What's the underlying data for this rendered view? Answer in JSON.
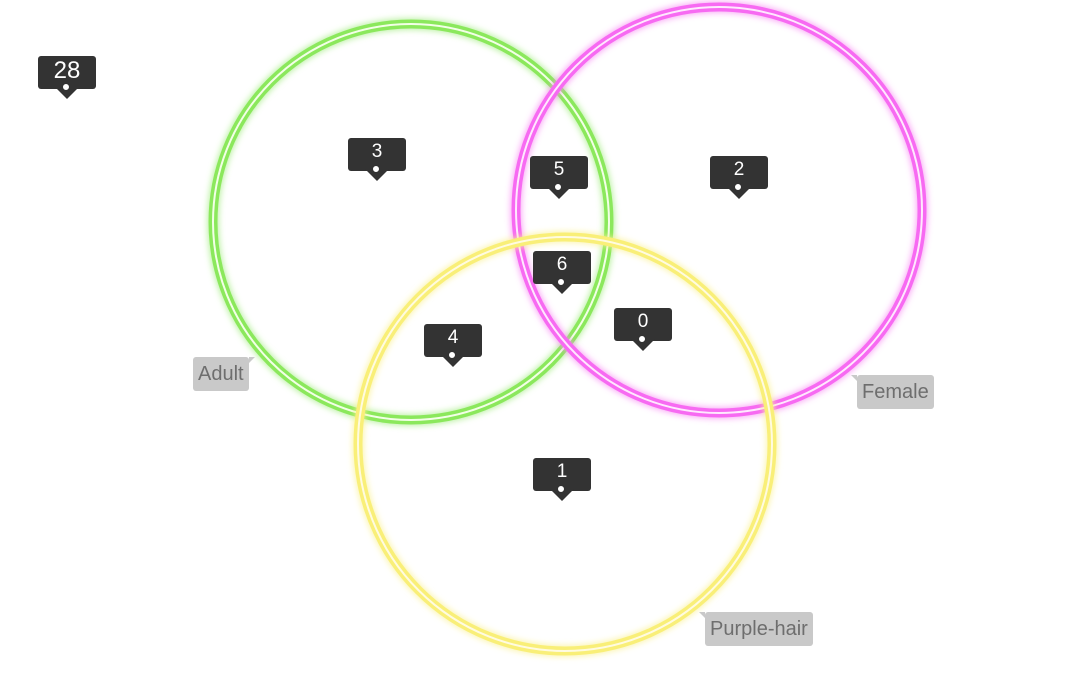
{
  "universe_count": "28",
  "regions": {
    "adult_only": "3",
    "female_only": "2",
    "purple_only": "1",
    "adult_female": "5",
    "adult_purple": "4",
    "female_purple": "0",
    "all_three": "6"
  },
  "sets": {
    "adult": {
      "label": "Adult",
      "color": "#7de84f"
    },
    "female": {
      "label": "Female",
      "color": "#f55cf0"
    },
    "purple": {
      "label": "Purple-hair",
      "color": "#f8ee6a"
    }
  }
}
